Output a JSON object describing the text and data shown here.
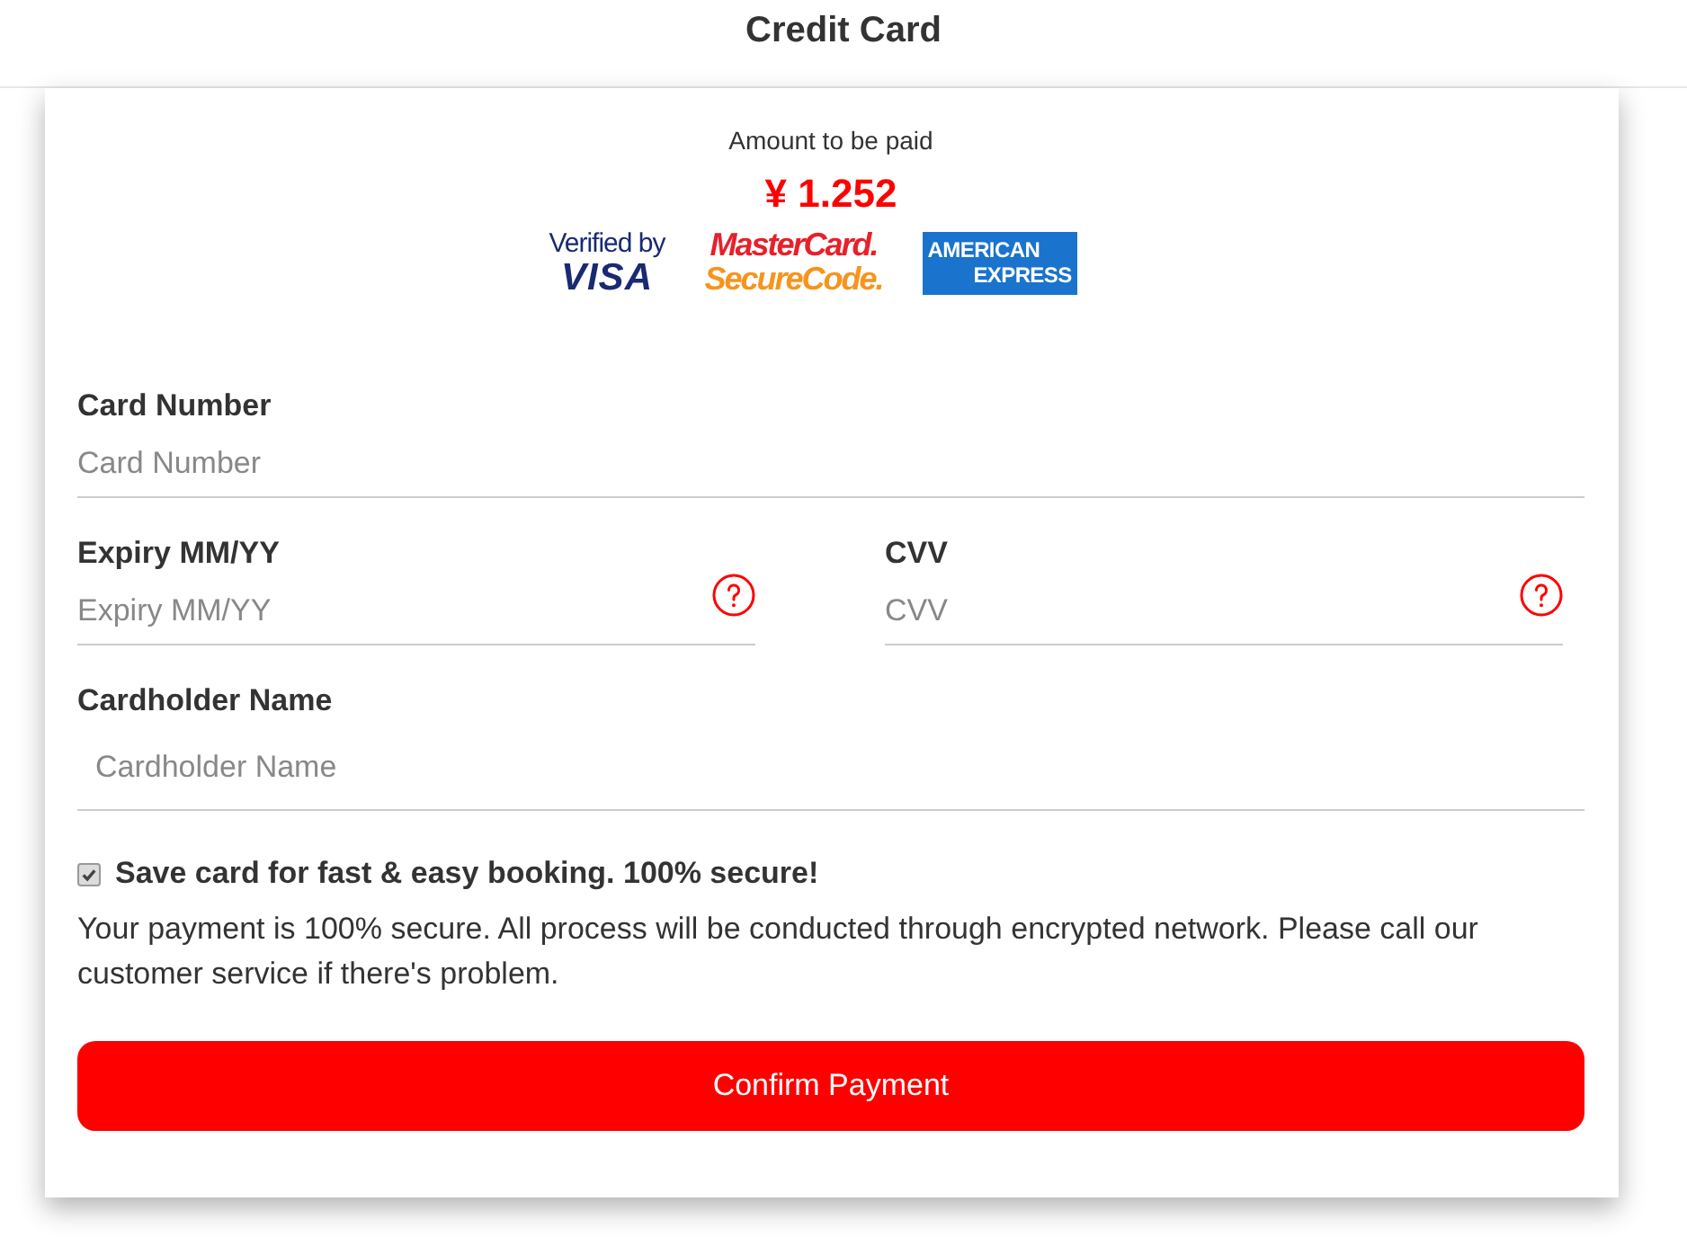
{
  "header": {
    "title": "Credit Card"
  },
  "summary": {
    "amount_label": "Amount to be paid",
    "amount": "¥ 1.252",
    "logos": [
      {
        "kind": "visa",
        "lines": [
          "Verified by",
          "VISA"
        ]
      },
      {
        "kind": "mastercard",
        "lines": [
          "MasterCard.",
          "SecureCode."
        ]
      },
      {
        "kind": "amex",
        "lines": [
          "AMERICAN",
          "EXPRESS"
        ]
      }
    ]
  },
  "form": {
    "rows": [
      {
        "fields": [
          {
            "kind": "plain",
            "label": "Card Number",
            "placeholder": "Card Number"
          }
        ]
      },
      {
        "fields": [
          {
            "kind": "help",
            "label": "Expiry MM/YY",
            "placeholder": "Expiry MM/YY"
          },
          {
            "kind": "help",
            "label": "CVV",
            "placeholder": "CVV"
          }
        ]
      },
      {
        "fields": [
          {
            "kind": "padded",
            "label": "Cardholder Name",
            "placeholder": "Cardholder Name"
          }
        ]
      }
    ],
    "save_card": {
      "label": "Save card for fast & easy booking. 100% secure!",
      "checked": true
    },
    "notice": "Your payment is 100% secure. All process will be conducted through encrypted network. Please call our customer service if there's problem.",
    "button": "Confirm Payment"
  }
}
